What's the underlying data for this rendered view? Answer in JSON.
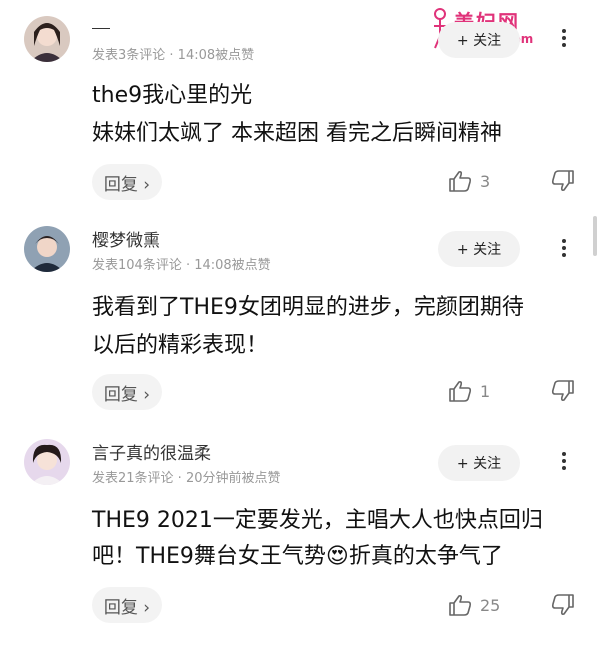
{
  "watermark": {
    "title": "美妇网",
    "url": "meifu3.com"
  },
  "comments": [
    {
      "name": "",
      "meta": "发表3条评论 · 14:08被点赞",
      "follow_label": "+ 关注",
      "lines": [
        "the9我心里的光",
        "妹妹们太飒了 本来超困 看完之后瞬间精神"
      ],
      "reply_label": "回复 ›",
      "likes": "3"
    },
    {
      "name": "樱梦微熏",
      "meta": "发表104条评论 · 14:08被点赞",
      "follow_label": "+ 关注",
      "lines": [
        "我看到了THE9女团明显的进步，完颜团期待",
        "以后的精彩表现！"
      ],
      "reply_label": "回复 ›",
      "likes": "1"
    },
    {
      "name": "言子真的很温柔",
      "meta": "发表21条评论 · 20分钟前被点赞",
      "follow_label": "+ 关注",
      "lines": [
        "THE9 2021一定要发光，主唱大人也快点回归",
        "吧！THE9舞台女王气势😍折真的太争气了"
      ],
      "reply_label": "回复 ›",
      "likes": "25"
    }
  ]
}
